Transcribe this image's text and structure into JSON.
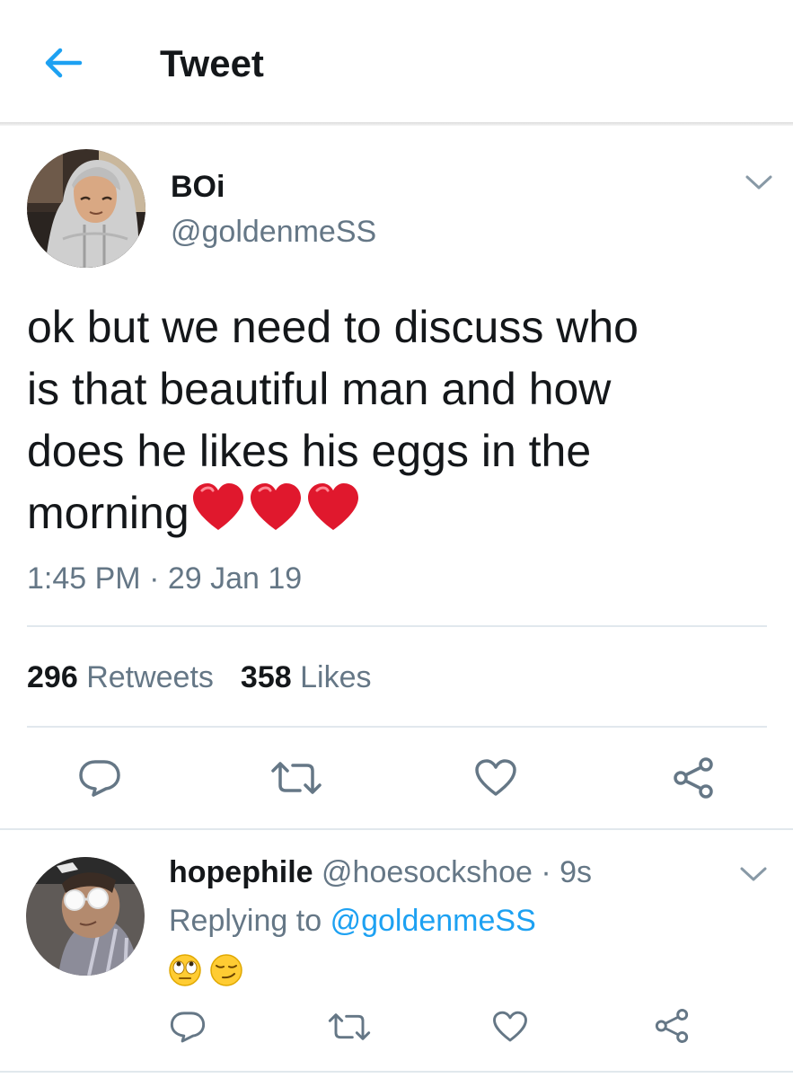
{
  "header": {
    "title": "Tweet",
    "back_icon": "arrow-left-icon"
  },
  "colors": {
    "accent": "#1da1f2",
    "muted": "#657786",
    "text": "#14171a",
    "heart": "#e0182d"
  },
  "tweet": {
    "author_name": "BOi",
    "author_handle": "@goldenmeSS",
    "text_lines": [
      "ok but we need to discuss who",
      "is that beautiful man and how",
      "does he likes his eggs in the",
      "morning"
    ],
    "emojis": [
      "red-heart",
      "red-heart",
      "red-heart"
    ],
    "timestamp": "1:45 PM · 29 Jan 19",
    "retweets_count": "296",
    "retweets_label": "Retweets",
    "likes_count": "358",
    "likes_label": "Likes"
  },
  "actions": [
    "reply-icon",
    "retweet-icon",
    "like-icon",
    "share-icon"
  ],
  "reply": {
    "name": "hopephile",
    "handle": "@hoesockshoe",
    "separator": " · ",
    "time": "9s",
    "replying_to_label": "Replying to",
    "replying_to_handle": "@goldenmeSS",
    "emojis": [
      "face-with-rolling-eyes",
      "smirking-face"
    ]
  }
}
